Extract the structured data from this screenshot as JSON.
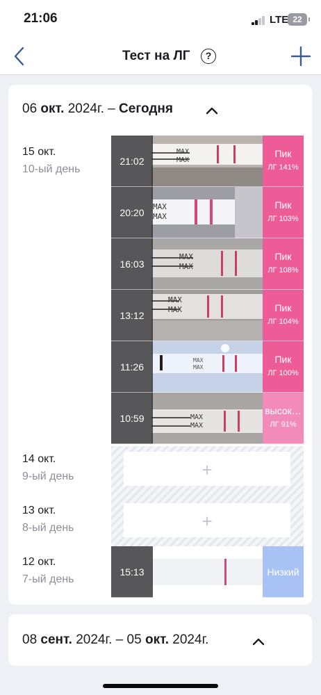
{
  "status_bar": {
    "time": "21:06",
    "network": "LTE",
    "battery": "22"
  },
  "nav": {
    "title": "Тест на ЛГ",
    "help_glyph": "?"
  },
  "sections": [
    {
      "label_pre": "06",
      "label_month": "окт.",
      "label_year": "2024",
      "label_tail": "г. –",
      "label_today": "Сегодня",
      "expanded": true
    },
    {
      "label_start_day": "08",
      "label_start_month": "сент.",
      "label_start_year": "2024",
      "label_mid": "г. –",
      "label_end_day": "05",
      "label_end_month": "окт.",
      "label_end_year": "2024",
      "label_tail": "г.",
      "expanded": true
    }
  ],
  "days": [
    {
      "date": "15 окт.",
      "cycle_day": "10-ый день",
      "tests": [
        {
          "time": "21:02",
          "result": "Пик",
          "detail": "ЛГ 141%",
          "level": "peak"
        },
        {
          "time": "20:20",
          "result": "Пик",
          "detail": "ЛГ 103%",
          "level": "peak"
        },
        {
          "time": "16:03",
          "result": "Пик",
          "detail": "ЛГ 108%",
          "level": "peak"
        },
        {
          "time": "13:12",
          "result": "Пик",
          "detail": "ЛГ 104%",
          "level": "peak"
        },
        {
          "time": "11:26",
          "result": "Пик",
          "detail": "ЛГ 100%",
          "level": "peak"
        },
        {
          "time": "10:59",
          "result": "высок…",
          "detail": "ЛГ 91%",
          "level": "high"
        }
      ]
    },
    {
      "date": "14 окт.",
      "cycle_day": "9-ый день",
      "add_glyph": "+"
    },
    {
      "date": "13 окт.",
      "cycle_day": "8-ый день",
      "add_glyph": "+"
    },
    {
      "date": "12 окт.",
      "cycle_day": "7-ый день",
      "tests": [
        {
          "time": "15:13",
          "result": "Низкий",
          "level": "low"
        }
      ]
    }
  ],
  "strip_text": "MAX",
  "colors": {
    "peak": "#ee5c98",
    "high": "#f28bb9",
    "low": "#a9c2f4",
    "accent": "#3b5b8f"
  }
}
